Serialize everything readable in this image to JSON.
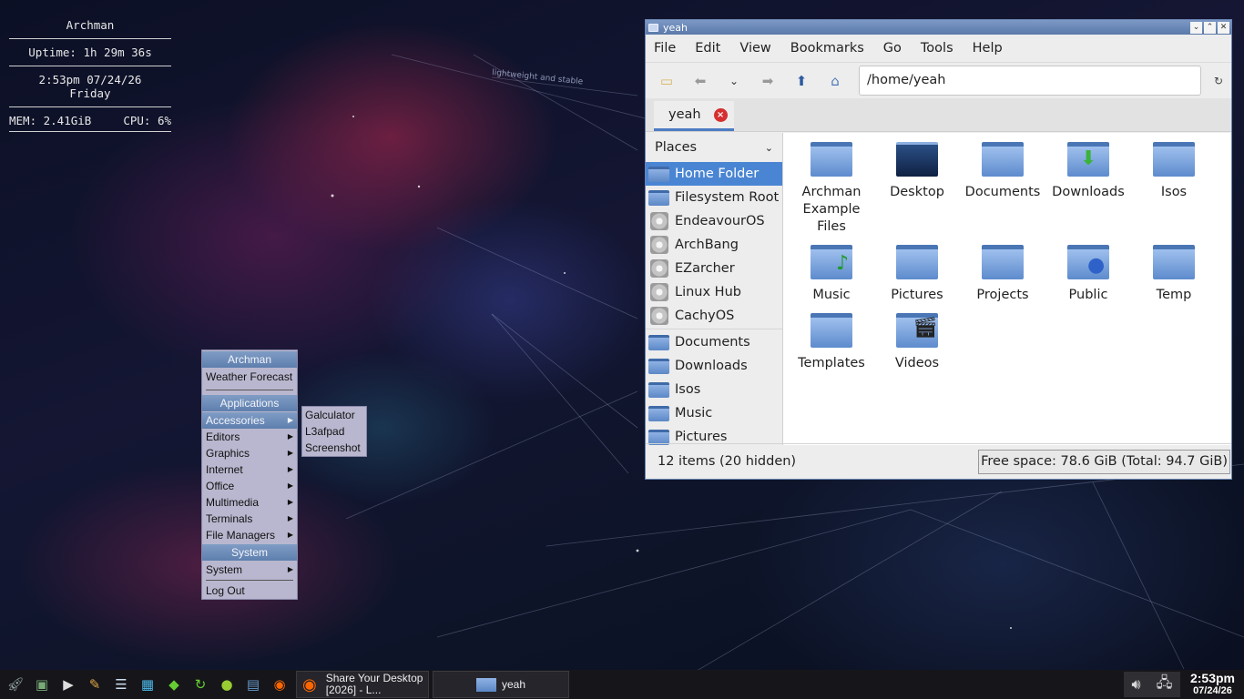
{
  "conky": {
    "host": "Archman",
    "uptime": "Uptime: 1h 29m 36s",
    "time": "2:53pm  07/24/26",
    "day": "Friday",
    "mem": "MEM: 2.41GiB",
    "cpu": "CPU: 6%"
  },
  "wallpaper_text": "lightweight and stable",
  "menu": {
    "header1": "Archman",
    "weather": "Weather Forecast",
    "header2": "Applications",
    "items": [
      "Accessories",
      "Editors",
      "Graphics",
      "Internet",
      "Office",
      "Multimedia",
      "Terminals",
      "File Managers"
    ],
    "header3": "System",
    "system": "System",
    "logout": "Log Out"
  },
  "submenu": {
    "items": [
      "Galculator",
      "L3afpad",
      "Screenshot"
    ]
  },
  "window": {
    "title": "yeah",
    "menus": [
      "File",
      "Edit",
      "View",
      "Bookmarks",
      "Go",
      "Tools",
      "Help"
    ],
    "path": "/home/yeah",
    "tab": "yeah",
    "places_label": "Places",
    "places": [
      "Home Folder",
      "Filesystem Root",
      "EndeavourOS",
      "ArchBang",
      "EZarcher",
      "Linux Hub",
      "CachyOS"
    ],
    "bookmarks": [
      "Documents",
      "Downloads",
      "Isos",
      "Music",
      "Pictures"
    ],
    "files": [
      "Archman Example Files",
      "Desktop",
      "Documents",
      "Downloads",
      "Isos",
      "Music",
      "Pictures",
      "Projects",
      "Public",
      "Temp",
      "Templates",
      "Videos"
    ],
    "status_left": "12 items (20 hidden)",
    "status_right": "Free space: 78.6 GiB (Total: 94.7 GiB)"
  },
  "taskbar": {
    "task1": "Share Your Desktop [2026] - L...",
    "task2": "yeah",
    "clock_time": "2:53pm",
    "clock_date": "07/24/26"
  },
  "colors": {
    "accent": "#4a85d3",
    "menu_header": "#5e7fae",
    "taskbar": "#16161a"
  }
}
